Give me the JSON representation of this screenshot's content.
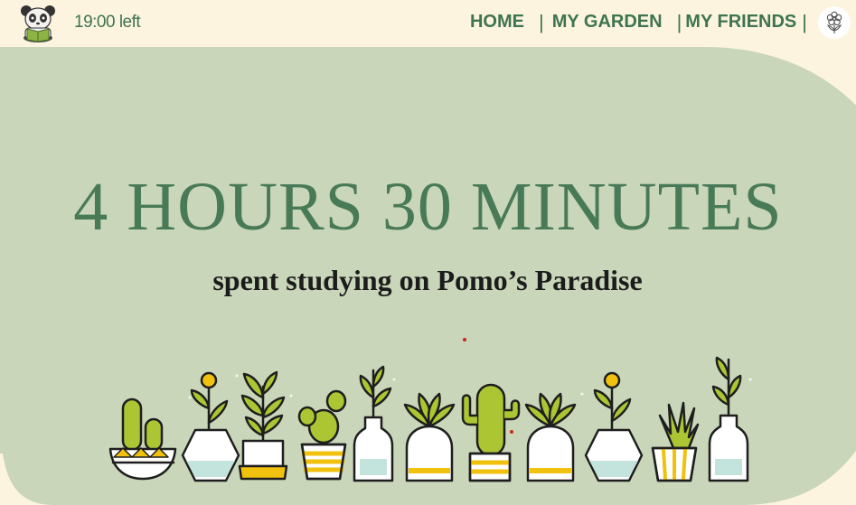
{
  "header": {
    "time_left": "19:00 left",
    "nav": {
      "home": "HOME",
      "garden": "MY GARDEN",
      "friends": "MY FRIENDS"
    },
    "separator": "|"
  },
  "main": {
    "headline": "4 HOURS 30 MINUTES",
    "subtitle": "spent studying on Pomo’s Paradise"
  },
  "colors": {
    "background": "#fcf4df",
    "panel": "#c9d6b9",
    "accent_green": "#497a57",
    "plant_green": "#abc533",
    "pot_yellow": "#f1c20d",
    "pot_water": "#c3e4dd"
  },
  "icons": {
    "avatar": "panda-reading-icon",
    "profile": "flower-icon"
  }
}
